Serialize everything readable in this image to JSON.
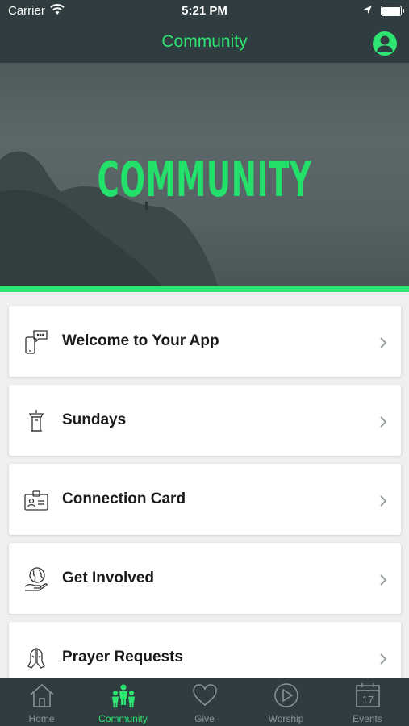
{
  "status_bar": {
    "carrier": "Carrier",
    "time": "5:21 PM"
  },
  "nav": {
    "title": "Community",
    "profile_icon": "user-icon"
  },
  "hero": {
    "text": "COMMUNITY"
  },
  "colors": {
    "accent": "#2ee572",
    "bar": "#2f3c40",
    "card": "#ffffff",
    "inactive": "#8a9598"
  },
  "menu": [
    {
      "label": "Welcome to Your App",
      "icon": "phone-chat-icon"
    },
    {
      "label": "Sundays",
      "icon": "pulpit-icon"
    },
    {
      "label": "Connection Card",
      "icon": "id-card-icon"
    },
    {
      "label": "Get Involved",
      "icon": "globe-hand-icon"
    },
    {
      "label": "Prayer Requests",
      "icon": "praying-hands-icon"
    }
  ],
  "tabs": [
    {
      "label": "Home",
      "icon": "home-icon",
      "active": false
    },
    {
      "label": "Community",
      "icon": "people-icon",
      "active": true
    },
    {
      "label": "Give",
      "icon": "heart-icon",
      "active": false
    },
    {
      "label": "Worship",
      "icon": "play-icon",
      "active": false
    },
    {
      "label": "Events",
      "icon": "calendar-icon",
      "active": false,
      "badge": "17"
    }
  ]
}
